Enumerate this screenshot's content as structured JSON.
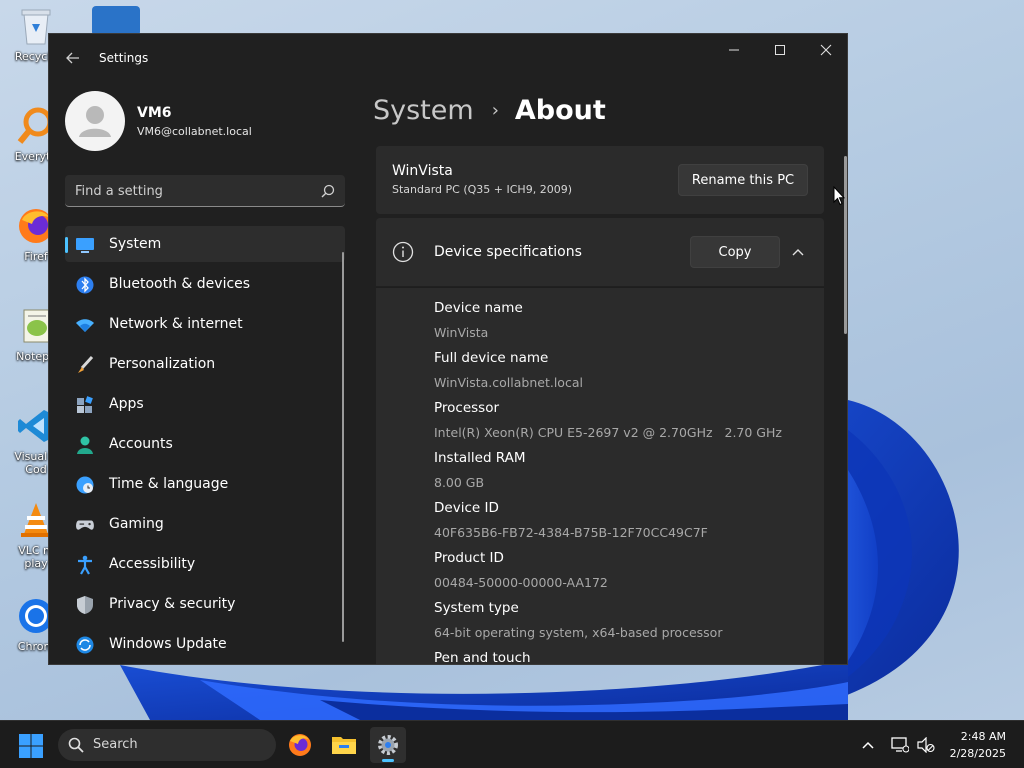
{
  "desktop": {
    "icons": [
      {
        "label": "Recycle",
        "icon": "recycle-bin-icon"
      },
      {
        "label": "Everyth",
        "icon": "everything-search-icon"
      },
      {
        "label": "Firef",
        "icon": "firefox-icon"
      },
      {
        "label": "Notepa",
        "icon": "notepad-plus-icon"
      },
      {
        "label": "Visual S\nCod",
        "icon": "vscode-icon"
      },
      {
        "label": "VLC m\nplay",
        "icon": "vlc-icon"
      },
      {
        "label": "Chrom",
        "icon": "chrome-icon"
      }
    ]
  },
  "window": {
    "app_title": "Settings",
    "controls": {
      "minimize": "—",
      "maximize": "☐",
      "close": "✕"
    }
  },
  "profile": {
    "name": "VM6",
    "email": "VM6@collabnet.local"
  },
  "search": {
    "placeholder": "Find a setting"
  },
  "nav": {
    "items": [
      {
        "label": "System",
        "icon": "system-monitor-icon",
        "selected": true
      },
      {
        "label": "Bluetooth & devices",
        "icon": "bluetooth-icon"
      },
      {
        "label": "Network & internet",
        "icon": "wifi-icon"
      },
      {
        "label": "Personalization",
        "icon": "brush-icon"
      },
      {
        "label": "Apps",
        "icon": "apps-icon"
      },
      {
        "label": "Accounts",
        "icon": "person-icon"
      },
      {
        "label": "Time & language",
        "icon": "globe-clock-icon"
      },
      {
        "label": "Gaming",
        "icon": "gamepad-icon"
      },
      {
        "label": "Accessibility",
        "icon": "accessibility-icon"
      },
      {
        "label": "Privacy & security",
        "icon": "shield-icon"
      },
      {
        "label": "Windows Update",
        "icon": "update-icon"
      }
    ]
  },
  "breadcrumb": {
    "parent": "System",
    "separator": "›",
    "current": "About"
  },
  "pc_card": {
    "name": "WinVista",
    "model": "Standard PC (Q35 + ICH9, 2009)",
    "rename_label": "Rename this PC"
  },
  "specs": {
    "title": "Device specifications",
    "copy_label": "Copy",
    "rows": [
      {
        "label": "Device name",
        "value": "WinVista"
      },
      {
        "label": "Full device name",
        "value": "WinVista.collabnet.local"
      },
      {
        "label": "Processor",
        "value": "Intel(R) Xeon(R) CPU E5-2697 v2 @ 2.70GHz   2.70 GHz"
      },
      {
        "label": "Installed RAM",
        "value": "8.00 GB"
      },
      {
        "label": "Device ID",
        "value": "40F635B6-FB72-4384-B75B-12F70CC49C7F"
      },
      {
        "label": "Product ID",
        "value": "00484-50000-00000-AA172"
      },
      {
        "label": "System type",
        "value": "64-bit operating system, x64-based processor"
      },
      {
        "label": "Pen and touch",
        "value": ""
      }
    ]
  },
  "taskbar": {
    "search_label": "Search",
    "time": "2:48 AM",
    "date": "2/28/2025"
  },
  "colors": {
    "accent": "#4cc2ff",
    "window_bg": "#202020",
    "card_bg": "#2b2b2b"
  }
}
